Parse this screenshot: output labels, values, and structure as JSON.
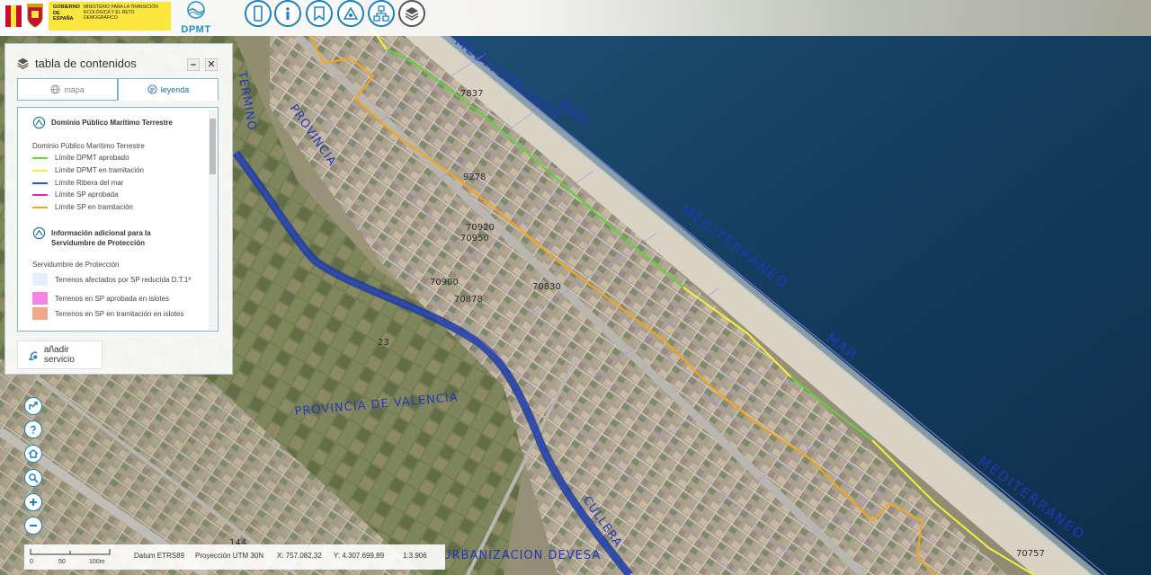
{
  "header": {
    "gobierno": "GOBIERNO DE ESPAÑA",
    "ministerio": "MINISTERIO PARA LA TRANSICIÓN ECOLÓGICA Y EL RETO DEMOGRÁFICO",
    "app_logo": "DPMT",
    "toolbar_icons": [
      "sidebar-icon",
      "info-icon",
      "bookmark-icon",
      "measure-icon",
      "network-icon",
      "layers-icon"
    ]
  },
  "toc": {
    "title": "tabla de contenidos",
    "tabs": [
      {
        "label": "mapa",
        "active": false
      },
      {
        "label": "leyenda",
        "active": true
      }
    ],
    "sections": [
      {
        "title": "Dominio Público Marítimo Terrestre",
        "subtitle": "Dominio Público Marítimo Terrestre",
        "items": [
          {
            "label": "Límite DPMT aprobado",
            "color": "#5fd43a"
          },
          {
            "label": "Límite DPMT en tramitación",
            "color": "#f2f23a"
          },
          {
            "label": "Límite Ribera del mar",
            "color": "#2457c5"
          },
          {
            "label": "Límite SP aprobada",
            "color": "#d92ac8"
          },
          {
            "label": "Límite SP en tramitación",
            "color": "#f0a71f"
          }
        ]
      },
      {
        "title": "Información adicional para la Servidumbre de Protección",
        "subtitle": "Servidumbre de Protección",
        "items": [
          {
            "label": "Terrenos afectados por SP reducida D.T.1ª",
            "color": "#e6eefb"
          },
          {
            "label": "Terrenos en SP aprobada en islotes",
            "color": "#f483e3"
          },
          {
            "label": "Terrenos en SP en tramitación en islotes",
            "color": "#f3a78a"
          }
        ]
      }
    ],
    "add_service": "añadir servicio"
  },
  "map_labels": [
    "MEDITERRANEO",
    "MAR",
    "MEDITERRANEO",
    "MAR",
    "MEDITERRANEO",
    "PROVINCIA",
    "PROVINCIA DE VALENCIA",
    "TERMINO",
    "URBANIZACION DEVESA",
    "CULLERA"
  ],
  "parcel_numbers": [
    "7837",
    "9278",
    "70920",
    "70950",
    "70900",
    "70830",
    "70878",
    "70757",
    "23",
    "144"
  ],
  "status_bar": {
    "scale_ticks": [
      "0",
      "50",
      "100m"
    ],
    "datum": "Datum ETRS89",
    "projection": "Proyección UTM 30N",
    "x": "X: 757.082,32",
    "y": "Y: 4.307.699,89",
    "scale": "1:3.906"
  },
  "left_tools": [
    "share-icon",
    "help-icon",
    "home-icon",
    "zoom-search-icon",
    "zoom-in-icon",
    "zoom-out-icon"
  ]
}
